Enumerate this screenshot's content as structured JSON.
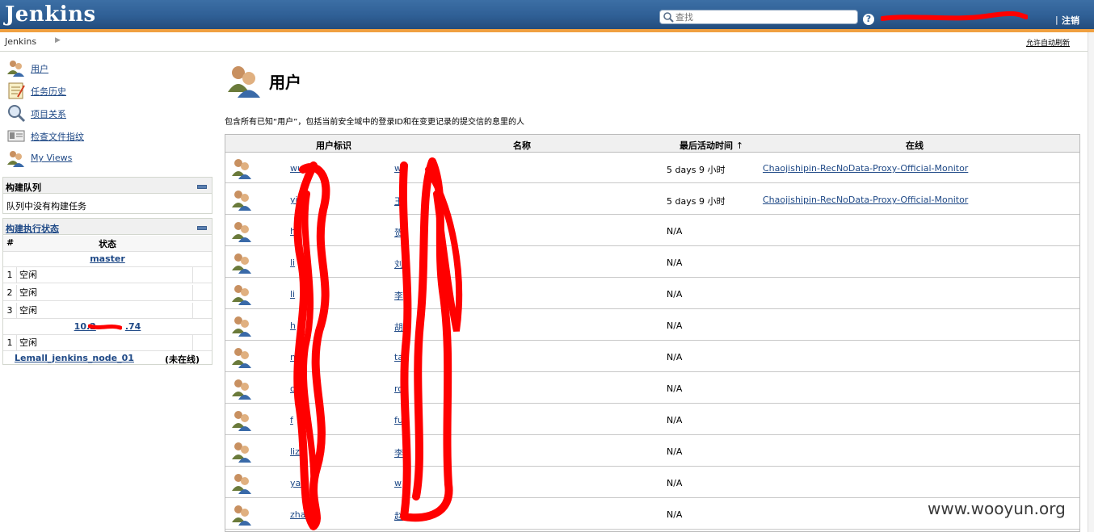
{
  "header": {
    "logo": "Jenkins",
    "search_placeholder": "查找",
    "help": "?",
    "separator": "|",
    "logout": "注销"
  },
  "breadcrumb": {
    "items": [
      "Jenkins"
    ],
    "auto_refresh": "允许自动刷新"
  },
  "side_tasks": [
    {
      "label": "用户",
      "icon": "people-icon"
    },
    {
      "label": "任务历史",
      "icon": "notepad-icon"
    },
    {
      "label": "项目关系",
      "icon": "search-icon"
    },
    {
      "label": "检查文件指纹",
      "icon": "fingerprint-icon"
    },
    {
      "label": "My Views",
      "icon": "people-icon"
    }
  ],
  "build_queue": {
    "title": "构建队列",
    "empty": "队列中没有构建任务"
  },
  "executors": {
    "title": "构建执行状态",
    "col_hash": "#",
    "col_status": "状态",
    "master": {
      "name": "master",
      "rows": [
        {
          "n": "1",
          "status": "空闲"
        },
        {
          "n": "2",
          "status": "空闲"
        },
        {
          "n": "3",
          "status": "空闲"
        }
      ]
    },
    "node2": {
      "name_left": "10.2",
      "name_right": ".74",
      "rows": [
        {
          "n": "1",
          "status": "空闲"
        }
      ]
    },
    "node3": {
      "name": "Lemall_jenkins_node_01",
      "status": "(未在线)"
    }
  },
  "main": {
    "title": "用户",
    "description": "包含所有已知“用户”，包括当前安全域中的登录ID和在变更记录的提交信的息里的人"
  },
  "people_table": {
    "columns": [
      "用户标识",
      "名称",
      "最后活动时间",
      "在线"
    ],
    "sort_indicator": "↑",
    "rows": [
      {
        "uid": "wu",
        "name": "w",
        "last": "5 days 9 小时",
        "online": "Chaojishipin-RecNoData-Proxy-Official-Monitor"
      },
      {
        "uid": "yi",
        "name": "王",
        "last": "5 days 9 小时",
        "online": "Chaojishipin-RecNoData-Proxy-Official-Monitor"
      },
      {
        "uid": "he",
        "name": "贺",
        "last": "N/A",
        "online": ""
      },
      {
        "uid": "li",
        "name": "刘",
        "last": "N/A",
        "online": ""
      },
      {
        "uid": "li",
        "name": "李",
        "last": "N/A",
        "online": ""
      },
      {
        "uid": "h",
        "name": "胡",
        "last": "N/A",
        "online": ""
      },
      {
        "uid": "ng",
        "name": "ta",
        "last": "N/A",
        "online": ""
      },
      {
        "uid": "ot",
        "name": "ro",
        "last": "N/A",
        "online": ""
      },
      {
        "uid": "f",
        "name": "fu",
        "last": "N/A",
        "online": ""
      },
      {
        "uid": "liz",
        "name": "李",
        "last": "N/A",
        "online": ""
      },
      {
        "uid": "yan",
        "name": "w",
        "last": "N/A",
        "online": ""
      },
      {
        "uid": "zha",
        "name": "赵",
        "last": "N/A",
        "online": ""
      }
    ]
  },
  "watermark": "www.wooyun.org",
  "colors": {
    "header": "#2f5f95",
    "accent_stripe": "#f0a040",
    "link": "#204a87",
    "redaction": "#ff0000"
  }
}
